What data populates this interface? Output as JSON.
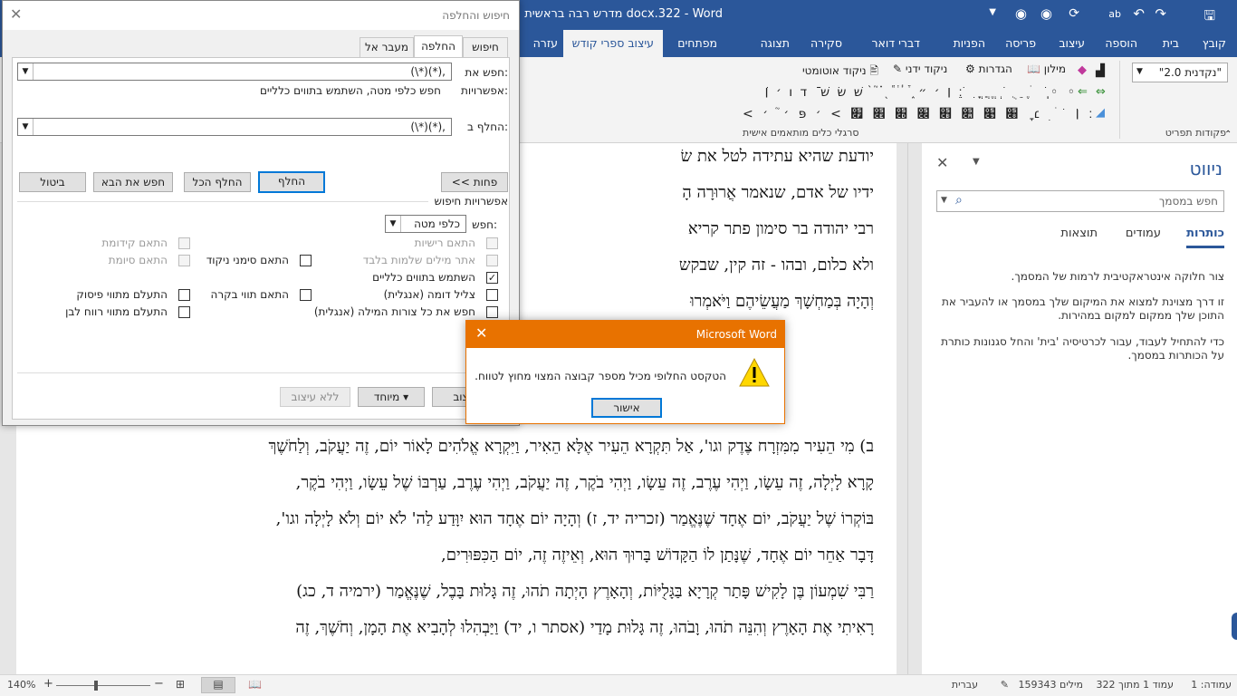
{
  "window": {
    "title": "מדרש רבה בראשית docx.322 - Word"
  },
  "ribbon_tabs": [
    "קובץ",
    "בית",
    "הוספה",
    "עיצוב",
    "פריסה",
    "הפניות",
    "דברי דואר",
    "סקירה",
    "תצוגה",
    "מפתחים",
    "עיצוב ספרי קודש",
    "עזרה"
  ],
  "ribbon": {
    "dropdown_value": "\"נקדנית 2.0\"",
    "group_label_right": "פקודות תפריט",
    "group_label_mid": "סרגלי כלים מותאמים אישית",
    "tools": [
      "מילון",
      "הגדרות",
      "ניקוד ידני",
      "ניקוד אוטומטי"
    ],
    "symbol_row1": "׃ ׀ ׳ ״ ֑ ֒ ֓ ֔ ֕ ֖ ֗ ֘ ֙ שׁ שׂ שׁ ֿ ד ו ׳ ׀ ׁ",
    "symbol_row2": "◦ ◦ ֽ ׁ ׄ ֶ ֵ ֻ ֹ ְ ֱ ֲ ֳ ִ ֺ ֵ",
    "symbol_row3": "< ׃ ׀ ׁ ׂ ׄ ׅ ׆ ׇ ׈ ׉ ׊ ׋ ׌ ׍ ׎ ׏ > ׳ פּ ׳ ֘ ׳"
  },
  "document": {
    "lines": [
      "יודעת שהיא עתידה לטל את שׂ",
      "ידיו של אדם, שנאמר אֲרוּרָה הָ",
      "רבי יהודה בר סימון פתר קריא",
      "ולא כלום, ובהו - זה קין, שבקש",
      "וְהָיָה בְּמַחְשָׁךְ מַעֲשֵׂיהֶם וַיֹּאמְרוּ",
      "ב) מִי הֵעִיר מִמִּזְרָח צֶדֶק וגו', אַל תִּקְרָא הֵעִיר אֶלָּא הֵאִיר, וַיִּקְרָא אֱלֹהִים לָאוֹר יוֹם, זֶה יַעֲקֹב, וְלַחֹשֶׁךְ",
      "קָרָא לָיְלָה, זֶה עֵשָׂו, וַיְהִי עֶרֶב, זֶה עֵשָׂו, וַיְהִי בֹקֶר, זֶה יַעֲקֹב, וַיְהִי עֶרֶב, עַרְבּוֹ שֶׁל עֵשָׂו, וַיְהִי בֹקֶר,",
      "בּוֹקְרוֹ שֶׁל יַעֲקֹב, יוֹם אֶחָד שֶׁנֶּאֱמַר (זכריה יד, ז) וְהָיָה יוֹם אֶחָד הוּא יִוָּדַע לַה' לֹא יוֹם וְלֹא לָיְלָה וגו',",
      "דָּבָר אַחֵר יוֹם אֶחָד, שֶׁנָּתַן לוֹ הַקָּדוֹשׁ בָּרוּךְ הוּא, וְאֵיזֶה זֶה, יוֹם הַכִּפּוּרִים,",
      "רַבִּי שִׁמְעוֹן בֶּן לָקִישׁ פָּתַר קְרָיָא בַּגָּלֻיּוֹת, וְהָאָרֶץ הָיְתָה תֹהוּ, זֶה גָּלוּת בָּבֶל, שֶׁנֶּאֱמַר (ירמיה ד, כג)",
      "רָאִיתִי אֶת הָאָרֶץ וְהִנֵּה תֹהוּ, וָבֹהוּ, זֶה גָּלוּת מָדַי (אסתר ו, יד) וַיַּבְהִלוּ לְהָבִיא אֶת הָמָן, וְחֹשֶׁךְ, זֶה"
    ]
  },
  "nav_pane": {
    "title": "ניווט",
    "search_placeholder": "חפש במסמך",
    "tabs": [
      "כותרות",
      "עמודים",
      "תוצאות"
    ],
    "paragraphs": [
      "צור חלוקה אינטראקטיבית לרמות של המסמך.",
      "זו דרך מצוינת למצוא את המיקום שלך במסמך או להעביר את התוכן שלך ממקום למקום במהירות.",
      "כדי להתחיל לעבוד, עבור לכרטיסיה 'בית' והחל סגנונות כותרת על הכותרות במסמך."
    ]
  },
  "status": {
    "page": "עמוד 1 מתוך 322",
    "words": "159343 מילים",
    "language": "עברית",
    "column": "עמודה: 1",
    "zoom": "140%",
    "zoom_fraction": 0.42
  },
  "find_dialog": {
    "title": "חיפוש והחלפה",
    "tabs": [
      "חיפוש",
      "החלפה",
      "מעבר אל"
    ],
    "find_label": "חפש את:",
    "find_value": "(\\*)(*),",
    "options_label": "אפשרויות:",
    "options_value": "חפש כלפי מטה, השתמש בתווים כלליים",
    "replace_label": "החלף ב:",
    "replace_value": "(\\*)(*),",
    "buttons": {
      "less": "<< פחות",
      "replace": "החלף",
      "replace_all": "החלף הכל",
      "find_next": "חפש את הבא",
      "cancel": "ביטול",
      "format": "עיצוב",
      "special": "מיוחד",
      "no_format": "ללא עיצוב"
    },
    "search_options_title": "אפשרויות חיפוש",
    "search_label": "חפש:",
    "search_direction": "כלפי מטה",
    "checkboxes": {
      "match_case": "התאם רישיות",
      "whole_words": "אתר מילים שלמות בלבד",
      "wildcards": "השתמש בתווים כלליים",
      "sounds_like": "צליל דומה (אנגלית)",
      "all_forms": "חפש את כל צורות המילה (אנגלית)",
      "match_prefix": "התאם קידומת",
      "match_suffix": "התאם סיומת",
      "match_diacritics": "התאם סימני ניקוד",
      "match_kashida": "התאם תווי בקרה",
      "ignore_punct": "התעלם מתווי פיסוק",
      "ignore_space": "התעלם מתווי רווח לבן"
    }
  },
  "msgbox": {
    "title": "Microsoft Word",
    "message": "הטקסט החלופי מכיל מספר קבוצה המצוי מחוץ לטווח.",
    "ok": "אישור"
  },
  "colors": {
    "word_blue": "#2b579a",
    "msg_orange": "#e87200"
  }
}
